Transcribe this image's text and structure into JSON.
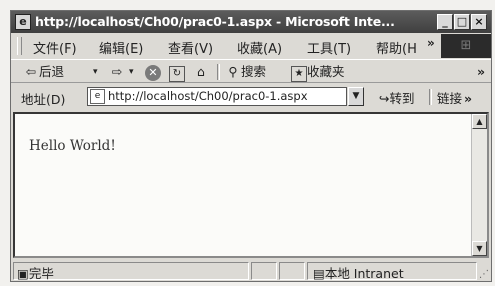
{
  "window": {
    "title": "http://localhost/Ch00/prac0-1.aspx - Microsoft Inte...",
    "min_label": "_",
    "max_label": "□",
    "close_label": "×"
  },
  "menu": {
    "items": [
      "文件(F)",
      "编辑(E)",
      "查看(V)",
      "收藏(A)",
      "工具(T)",
      "帮助(H"
    ],
    "more": "»"
  },
  "toolbar": {
    "back_label": "后退",
    "search_label": "搜索",
    "favorites_label": "收藏夹",
    "more": "»"
  },
  "address": {
    "label": "地址(D)",
    "url": "http://localhost/Ch00/prac0-1.aspx",
    "go_label": "转到",
    "links_label": "链接",
    "more": "»"
  },
  "page": {
    "body_text": "Hello World!"
  },
  "status": {
    "text": "完毕",
    "zone": "本地 Intranet"
  }
}
